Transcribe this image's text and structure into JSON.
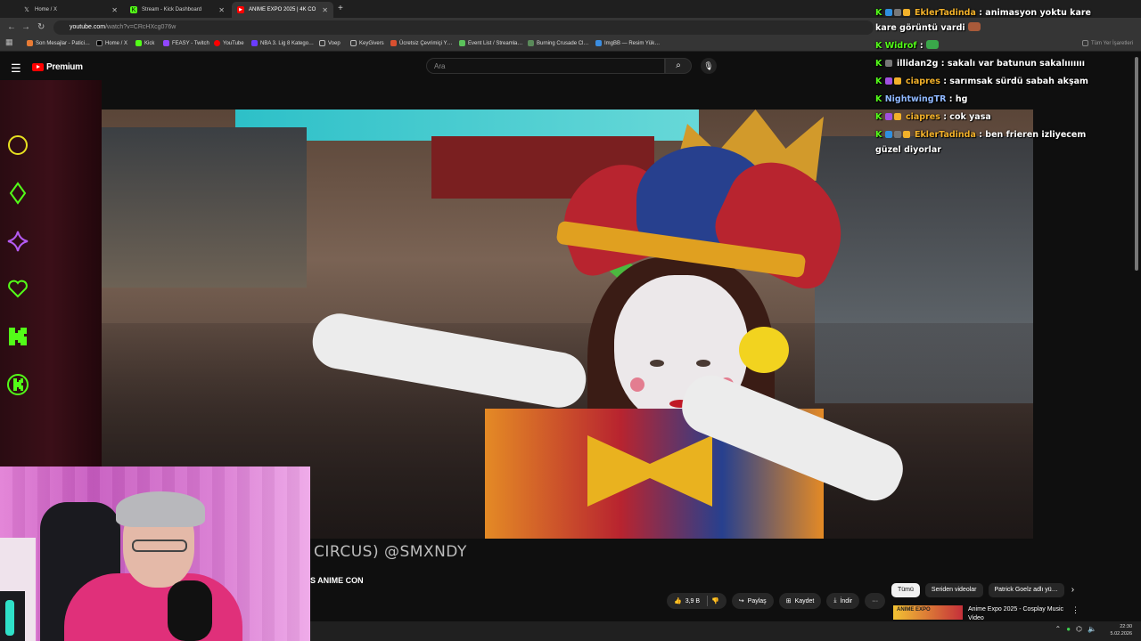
{
  "browser": {
    "tabs": [
      {
        "title": "Home / X",
        "icon": "x-icon"
      },
      {
        "title": "Stream - Kick Dashboard",
        "icon": "kick-icon"
      },
      {
        "title": "ANIME EXPO 2025 | 4K CO",
        "icon": "youtube-icon"
      }
    ],
    "new_tab": "+",
    "url_host": "youtube.com",
    "url_path": "/watch?v=CRcHXcg076w",
    "bookmarks": [
      "Son Mesajlar - Patici…",
      "Home / X",
      "Kick",
      "FEASY - Twitch",
      "YouTube",
      "NBA 3. Lig 8 Katego…",
      "Voep",
      "KeyGivers",
      "Ücretsiz Çevrimiçi Y…",
      "Event List / Streamla…",
      "Burning Crusade Cl…",
      "ImgBB — Resim Yük…"
    ],
    "bookmarks_right": "Tüm Yer İşaretleri"
  },
  "youtube": {
    "logo_text": "Premium",
    "search_placeholder": "Ara",
    "video_watermark": "CIRCUS) @SMXNDY",
    "video_title_partial": "S ANIME CON",
    "actions": {
      "likes": "3,9 B",
      "share": "Paylaş",
      "save": "Kaydet",
      "download": "İndir",
      "more": "···"
    },
    "chips": [
      "Tümü",
      "Seriden videolar",
      "Patrick Goelz adlı yü…"
    ],
    "recommendation": {
      "thumb_text": "ANIME EXPO",
      "title": "Anime Expo 2025 - Cosplay Music Video"
    }
  },
  "taskbar": {
    "time": "22:30",
    "date": "5.02.2026"
  },
  "chat": [
    {
      "user": "EklerTadinda",
      "user_color": "#f2b12a",
      "text": ": animasyon yoktu kare kare görüntü vardi"
    },
    {
      "user": "Widrof",
      "user_color": "#53fc18",
      "text": ":"
    },
    {
      "user": "illidan2g",
      "user_color": "#ffffff",
      "text": ": sakalı var batunun sakalııııııı"
    },
    {
      "user": "ciapres",
      "user_color": "#f2b12a",
      "text": ": sarımsak sürdü sabah akşam"
    },
    {
      "user": "NightwingTR",
      "user_color": "#8fb8ff",
      "text": ": hg"
    },
    {
      "user": "ciapres",
      "user_color": "#f2b12a",
      "text": ": cok yasa"
    },
    {
      "user": "EklerTadinda",
      "user_color": "#f2b12a",
      "text": ": ben frieren izliyecem güzel diyorlar"
    }
  ],
  "colors": {
    "kick_green": "#53fc18",
    "youtube_red": "#ff0000",
    "sidebar_dark_red": "#3b0f18"
  }
}
